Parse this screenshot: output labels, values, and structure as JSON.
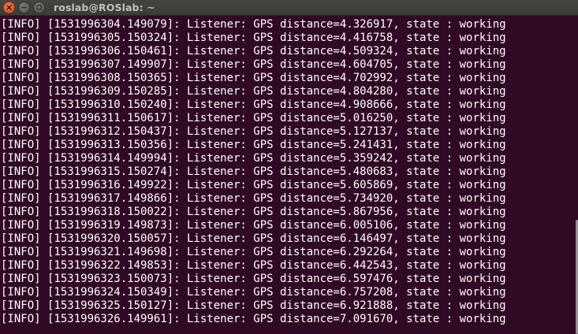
{
  "window": {
    "title": "roslab@ROSlab: ~"
  },
  "terminal": {
    "lines": [
      "[INFO] [1531996304.149079]: Listener: GPS distance=4.326917, state : working",
      "[INFO] [1531996305.150324]: Listener: GPS distance=4.416758, state : working",
      "[INFO] [1531996306.150461]: Listener: GPS distance=4.509324, state : working",
      "[INFO] [1531996307.149907]: Listener: GPS distance=4.604705, state : working",
      "[INFO] [1531996308.150365]: Listener: GPS distance=4.702992, state : working",
      "[INFO] [1531996309.150285]: Listener: GPS distance=4.804280, state : working",
      "[INFO] [1531996310.150240]: Listener: GPS distance=4.908666, state : working",
      "[INFO] [1531996311.150617]: Listener: GPS distance=5.016250, state : working",
      "[INFO] [1531996312.150437]: Listener: GPS distance=5.127137, state : working",
      "[INFO] [1531996313.150356]: Listener: GPS distance=5.241431, state : working",
      "[INFO] [1531996314.149994]: Listener: GPS distance=5.359242, state : working",
      "[INFO] [1531996315.150274]: Listener: GPS distance=5.480683, state : working",
      "[INFO] [1531996316.149922]: Listener: GPS distance=5.605869, state : working",
      "[INFO] [1531996317.149866]: Listener: GPS distance=5.734920, state : working",
      "[INFO] [1531996318.150022]: Listener: GPS distance=5.867956, state : working",
      "[INFO] [1531996319.149873]: Listener: GPS distance=6.005106, state : working",
      "[INFO] [1531996320.150057]: Listener: GPS distance=6.146497, state : working",
      "[INFO] [1531996321.149698]: Listener: GPS distance=6.292264, state : working",
      "[INFO] [1531996322.149853]: Listener: GPS distance=6.442543, state : working",
      "[INFO] [1531996323.150073]: Listener: GPS distance=6.597476, state : working",
      "[INFO] [1531996324.150349]: Listener: GPS distance=6.757208, state : working",
      "[INFO] [1531996325.150127]: Listener: GPS distance=6.921888, state : working",
      "[INFO] [1531996326.149961]: Listener: GPS distance=7.091670, state : working"
    ]
  },
  "colors": {
    "terminal_background": "#300a24",
    "terminal_text": "#ffffff",
    "titlebar_background": "#3c3b37",
    "title_text": "#c2c1bc",
    "close_button": "#e0582a"
  },
  "icons": {
    "close": "close-icon",
    "minimize": "minimize-icon",
    "maximize": "maximize-icon"
  }
}
